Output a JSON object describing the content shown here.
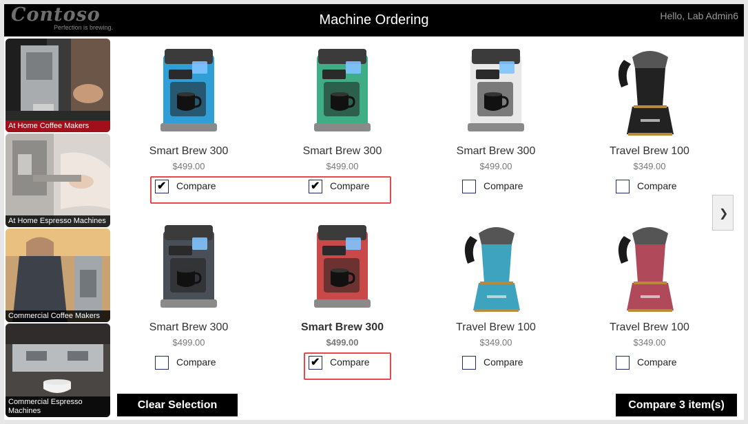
{
  "header": {
    "logo_text": "Contoso",
    "tagline": "Perfection is brewing.",
    "title": "Machine Ordering",
    "greeting": "Hello, Lab Admin6"
  },
  "categories": [
    {
      "label": "At Home Coffee Makers",
      "active": true
    },
    {
      "label": "At Home Espresso Machines",
      "active": false
    },
    {
      "label": "Commercial Coffee Makers",
      "active": false
    },
    {
      "label": "Commercial Espresso Machines",
      "active": false
    }
  ],
  "products": [
    {
      "name": "Smart Brew 300",
      "price": "$499.00",
      "color": "#2f9fd6",
      "kind": "brewer",
      "checked": true,
      "bold": false,
      "compare_label": "Compare"
    },
    {
      "name": "Smart Brew 300",
      "price": "$499.00",
      "color": "#3fae86",
      "kind": "brewer",
      "checked": true,
      "bold": false,
      "compare_label": "Compare"
    },
    {
      "name": "Smart Brew 300",
      "price": "$499.00",
      "color": "#e8e8e8",
      "kind": "brewer",
      "checked": false,
      "bold": false,
      "compare_label": "Compare"
    },
    {
      "name": "Travel Brew 100",
      "price": "$349.00",
      "color": "#222222",
      "kind": "travel",
      "checked": false,
      "bold": false,
      "compare_label": "Compare"
    },
    {
      "name": "Smart Brew 300",
      "price": "$499.00",
      "color": "#4a4f57",
      "kind": "brewer",
      "checked": false,
      "bold": false,
      "compare_label": "Compare"
    },
    {
      "name": "Smart Brew 300",
      "price": "$499.00",
      "color": "#c94848",
      "kind": "brewer",
      "checked": true,
      "bold": true,
      "compare_label": "Compare"
    },
    {
      "name": "Travel Brew 100",
      "price": "$349.00",
      "color": "#3da3bf",
      "kind": "travel",
      "checked": false,
      "bold": false,
      "compare_label": "Compare"
    },
    {
      "name": "Travel Brew 100",
      "price": "$349.00",
      "color": "#b04a5a",
      "kind": "travel",
      "checked": false,
      "bold": false,
      "compare_label": "Compare"
    }
  ],
  "actions": {
    "clear_label": "Clear Selection",
    "compare_label": "Compare 3 item(s)"
  },
  "pager": {
    "next_icon": "chevron-right-icon"
  },
  "colors": {
    "header_bg": "#000000",
    "accent_red": "#a00f1a",
    "highlight": "#e8474c"
  }
}
